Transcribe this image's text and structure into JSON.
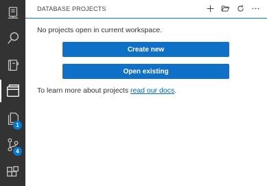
{
  "activity_bar": {
    "items": [
      {
        "name": "connections-icon"
      },
      {
        "name": "search-icon"
      },
      {
        "name": "notebooks-icon"
      },
      {
        "name": "projects-icon",
        "active": true
      },
      {
        "name": "explorer-icon",
        "badge": "1"
      },
      {
        "name": "source-control-icon",
        "badge": "4"
      },
      {
        "name": "extensions-icon"
      }
    ],
    "background": "#333333",
    "badge_color": "#0078d4"
  },
  "panel": {
    "title": "DATABASE PROJECTS",
    "actions": [
      {
        "name": "new-project-icon"
      },
      {
        "name": "open-folder-icon"
      },
      {
        "name": "refresh-icon"
      },
      {
        "name": "more-actions-icon"
      }
    ],
    "empty_message": "No projects open in current workspace.",
    "create_label": "Create new",
    "open_label": "Open existing",
    "learn_text": "To learn more about projects ",
    "learn_link": "read our docs",
    "learn_suffix": ".",
    "accent": "#0e70c6"
  }
}
